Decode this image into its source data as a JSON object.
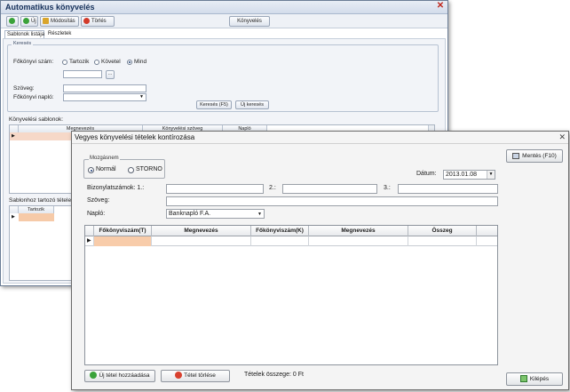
{
  "back_window": {
    "title": "Automatikus könyvelés",
    "toolbar": {
      "new_label": "Új",
      "edit_label": "Módosítás",
      "delete_label": "Törlés",
      "post_label": "Könyvelés"
    },
    "tabs": [
      {
        "label": "Sablonok listája"
      },
      {
        "label": "Részletek"
      }
    ],
    "search": {
      "group_title": "Keresés",
      "account_label": "Főkönyvi szám:",
      "radio_debit": "Tartozik",
      "radio_credit": "Követel",
      "radio_all": "Mind",
      "text_label": "Szöveg:",
      "journal_label": "Főkönyvi napló:",
      "search_button": "Keresés (F5)",
      "new_search_button": "Új keresés"
    },
    "templates_label": "Könyvelési sablonok:",
    "templates_columns": [
      "Megnevezés",
      "Könyvelési szöveg",
      "Napló"
    ],
    "items_label": "Sablonhoz tartozó tételek",
    "items_columns": [
      "Tartozik"
    ]
  },
  "dialog": {
    "title": "Vegyes könyvelési tételek kontírozása",
    "movement_group": "Mozgásnem",
    "radio_normal": "Normál",
    "radio_storno": "STORNO",
    "date_label": "Dátum:",
    "date_value": "2013.01.08",
    "voucher_label": "Bizonylatszámok: 1.:",
    "voucher2_label": "2.:",
    "voucher3_label": "3.:",
    "text_label": "Szöveg:",
    "journal_label": "Napló:",
    "journal_value": "Banknapló F.A.",
    "grid_columns": [
      "Főkönyviszám(T)",
      "Megnevezés",
      "Főkönyviszám(K)",
      "Megnevezés",
      "Összeg"
    ],
    "add_item_button": "Új tétel hozzáadása",
    "delete_item_button": "Tétel törlése",
    "total_text": "Tételek összege: 0 Ft",
    "save_button": "Mentés (F10)",
    "exit_button": "Kilépés"
  }
}
